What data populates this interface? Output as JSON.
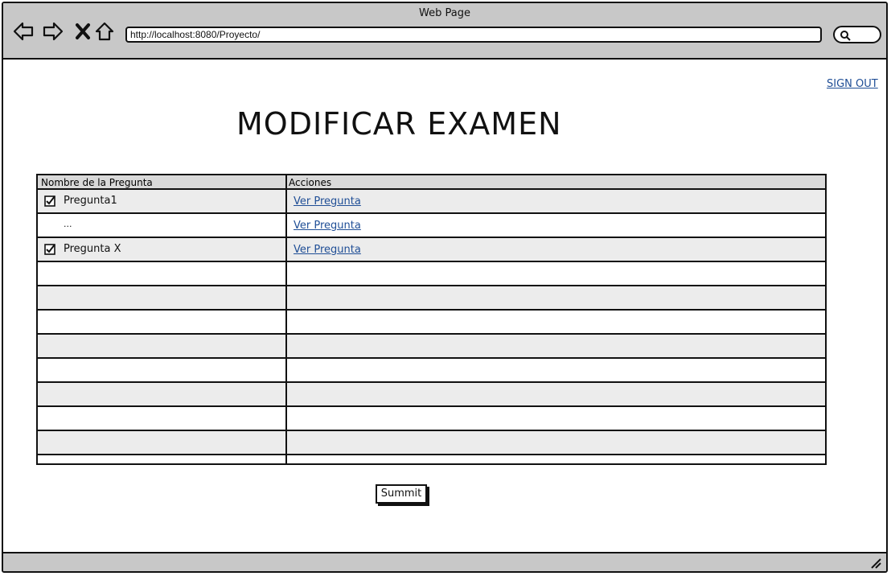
{
  "window": {
    "title": "Web Page"
  },
  "browser": {
    "url": "http://localhost:8080/Proyecto/",
    "icons": [
      "back-arrow-icon",
      "forward-arrow-icon",
      "stop-x-icon",
      "home-icon",
      "search-icon"
    ]
  },
  "header": {
    "signout_label": "SIGN OUT"
  },
  "page": {
    "title": "MODIFICAR EXAMEN"
  },
  "table": {
    "columns": [
      "Nombre de la Pregunta",
      "Acciones"
    ],
    "rows": [
      {
        "checked": true,
        "name": "Pregunta1",
        "action": "Ver Pregunta"
      },
      {
        "checked": false,
        "name": "...",
        "action": "Ver Pregunta"
      },
      {
        "checked": true,
        "name": "Pregunta X",
        "action": "Ver Pregunta"
      }
    ]
  },
  "footer": {
    "submit_label": "Summit"
  },
  "colors": {
    "chrome": "#c8c8c8",
    "link": "#1f4e96",
    "row_alt": "#ececec",
    "header_bg": "#d9d9d9"
  }
}
